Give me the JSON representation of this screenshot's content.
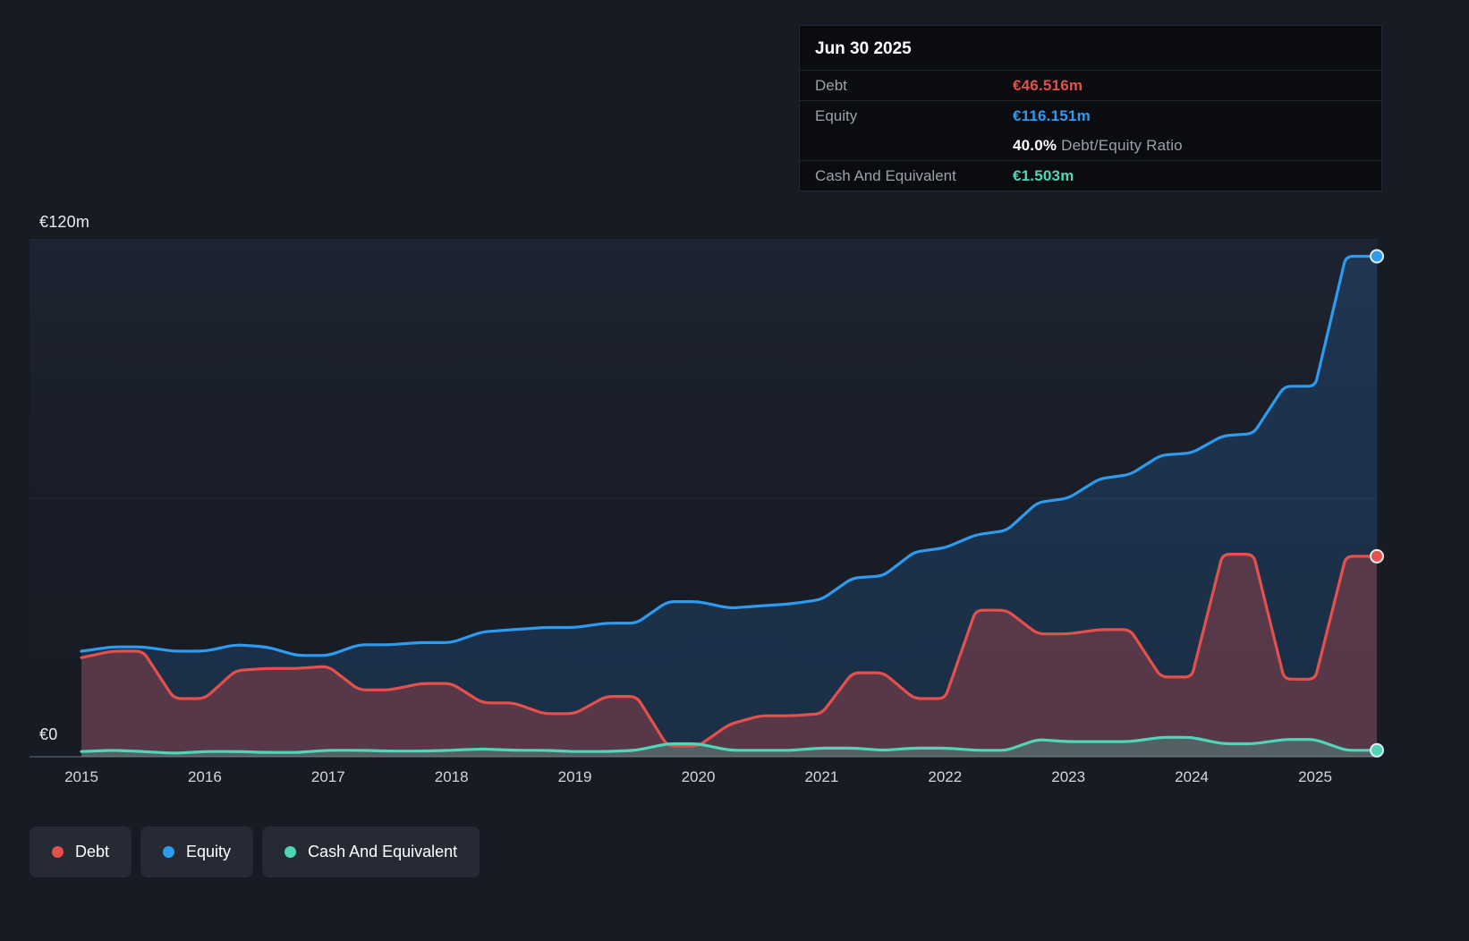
{
  "colors": {
    "debt": "#e4504b",
    "equity": "#2d9bf0",
    "cash": "#4fd6b8",
    "background": "#171b24",
    "tooltip_bg": "#0a0c10",
    "grid": "#262c37",
    "axis": "#4a5263"
  },
  "y_axis": {
    "top": "€120m",
    "zero": "€0"
  },
  "tooltip": {
    "date": "Jun 30 2025",
    "debt_label": "Debt",
    "debt_value": "€46.516m",
    "equity_label": "Equity",
    "equity_value": "€116.151m",
    "ratio_value": "40.0%",
    "ratio_label": "Debt/Equity Ratio",
    "cash_label": "Cash And Equivalent",
    "cash_value": "€1.503m"
  },
  "legend": {
    "items": [
      {
        "label": "Debt",
        "color": "#e4504b"
      },
      {
        "label": "Equity",
        "color": "#2d9bf0"
      },
      {
        "label": "Cash And Equivalent",
        "color": "#4fd6b8"
      }
    ]
  },
  "chart_data": {
    "type": "area",
    "x_unit": "year (quarterly)",
    "ylim": [
      0,
      120
    ],
    "gridlines": [
      0,
      60,
      120
    ],
    "grid": "horizontal",
    "legend_position": "bottom-left",
    "x_tick_labels": [
      "2015",
      "2016",
      "2017",
      "2018",
      "2019",
      "2020",
      "2021",
      "2022",
      "2023",
      "2024",
      "2025"
    ],
    "x": [
      2015,
      2015.25,
      2015.5,
      2015.75,
      2016,
      2016.25,
      2016.5,
      2016.75,
      2017,
      2017.25,
      2017.5,
      2017.75,
      2018,
      2018.25,
      2018.5,
      2018.75,
      2019,
      2019.25,
      2019.5,
      2019.75,
      2020,
      2020.25,
      2020.5,
      2020.75,
      2021,
      2021.25,
      2021.5,
      2021.75,
      2022,
      2022.25,
      2022.5,
      2022.75,
      2023,
      2023.25,
      2023.5,
      2023.75,
      2024,
      2024.25,
      2024.5,
      2024.75,
      2025,
      2025.25,
      2025.5
    ],
    "series": [
      {
        "name": "Debt",
        "color": "#e4504b",
        "fill": "rgba(228,80,75,0.30)",
        "values": [
          23,
          24.5,
          24.5,
          13.5,
          13.5,
          20,
          20.5,
          20.5,
          21,
          15.5,
          15.5,
          17,
          17,
          12.5,
          12.5,
          10,
          10,
          14,
          14,
          2.5,
          2.5,
          7.5,
          9.5,
          9.5,
          10,
          19.5,
          19.5,
          13.5,
          13.5,
          34,
          34,
          28.5,
          28.5,
          29.5,
          29.5,
          18.5,
          18.5,
          47,
          47,
          18,
          18,
          46.516,
          46.516
        ]
      },
      {
        "name": "Equity",
        "color": "#2d9bf0",
        "fill": "rgba(45,130,217,0.20)",
        "values": [
          24.5,
          25.5,
          25.5,
          24.5,
          24.5,
          26,
          25.5,
          23.5,
          23.5,
          26,
          26,
          26.5,
          26.5,
          29,
          29.5,
          30,
          30,
          31,
          31,
          36,
          36,
          34.5,
          35,
          35.5,
          36.5,
          41.5,
          42,
          47.5,
          48.5,
          51.5,
          52.5,
          59,
          60,
          64.5,
          65.5,
          70,
          70.5,
          74.5,
          75,
          86,
          86,
          116.151,
          116.151
        ]
      },
      {
        "name": "Cash And Equivalent",
        "color": "#4fd6b8",
        "fill": "rgba(79,214,184,0.25)",
        "values": [
          1.2,
          1.5,
          1.2,
          0.8,
          1.2,
          1.2,
          1,
          1,
          1.5,
          1.5,
          1.3,
          1.3,
          1.5,
          1.8,
          1.5,
          1.5,
          1.2,
          1.2,
          1.5,
          3,
          3,
          1.5,
          1.5,
          1.5,
          2,
          2,
          1.5,
          2,
          2,
          1.5,
          1.5,
          4,
          3.5,
          3.5,
          3.5,
          4.5,
          4.5,
          3,
          3,
          4,
          4,
          1.503,
          1.503
        ]
      }
    ]
  }
}
